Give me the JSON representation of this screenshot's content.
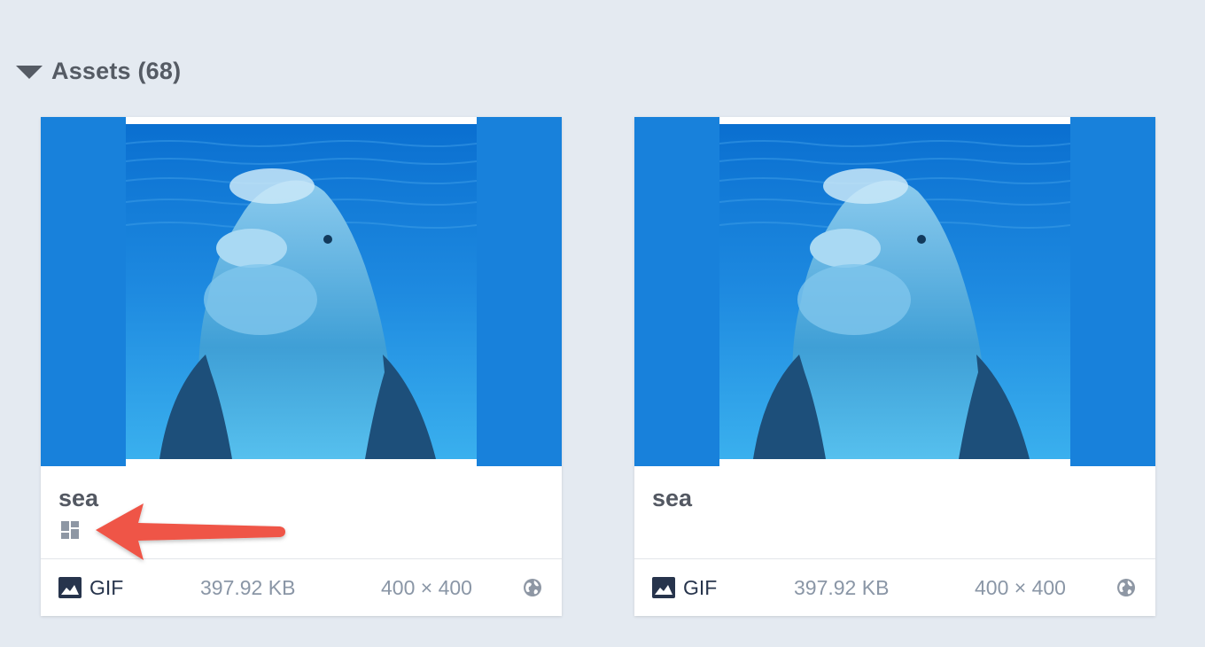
{
  "section": {
    "title": "Assets (68)"
  },
  "assets": [
    {
      "name": "sea",
      "type": "GIF",
      "size": "397.92 KB",
      "dimensions": "400 × 400",
      "has_layout_icon": true
    },
    {
      "name": "sea",
      "type": "GIF",
      "size": "397.92 KB",
      "dimensions": "400 × 400",
      "has_layout_icon": false
    }
  ],
  "icons": {
    "section_toggle": "caret-down-icon",
    "layout": "layout-grid-icon",
    "type": "image-icon",
    "visibility": "globe-icon",
    "annotation": "red-arrow"
  },
  "colors": {
    "background": "#e4eaf1",
    "thumbnail_fill": "#1881db",
    "annotation_arrow": "#ef5446"
  }
}
